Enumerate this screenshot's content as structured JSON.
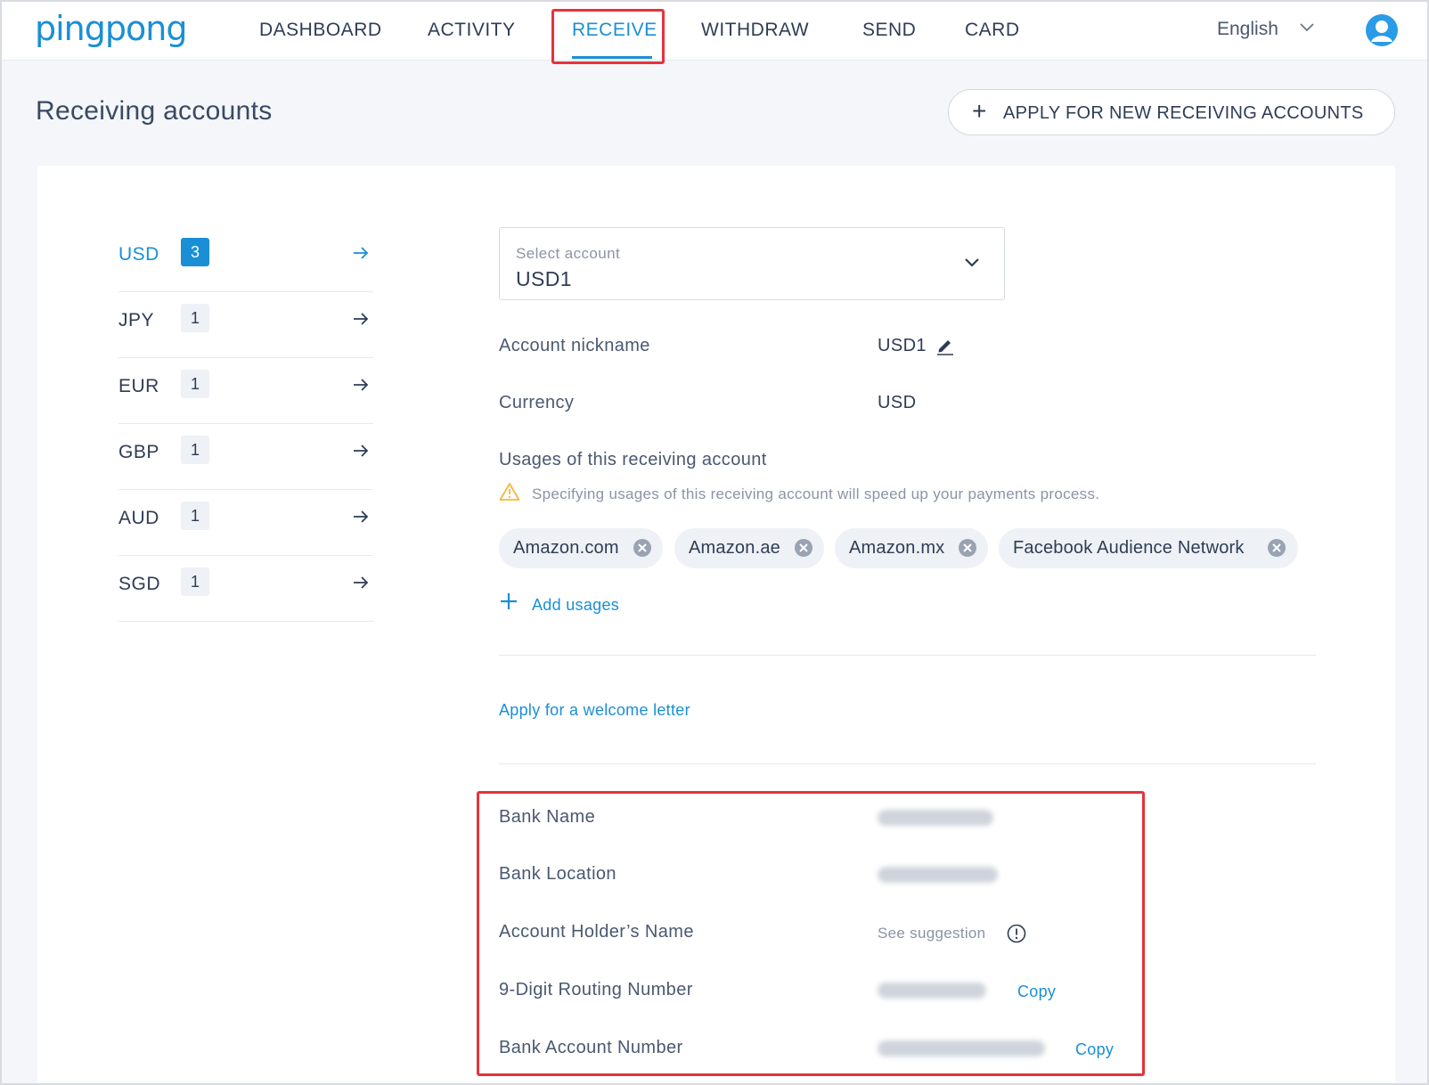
{
  "brand": {
    "logo_text": "pingpong",
    "accent": "#1a8fd6",
    "highlight": "#e7323a"
  },
  "nav": {
    "items": [
      {
        "label": "DASHBOARD"
      },
      {
        "label": "ACTIVITY"
      },
      {
        "label": "RECEIVE",
        "active": true
      },
      {
        "label": "WITHDRAW"
      },
      {
        "label": "SEND"
      },
      {
        "label": "CARD"
      }
    ],
    "language": "English",
    "avatar_icon": "user-avatar-icon"
  },
  "header": {
    "title": "Receiving accounts",
    "apply_button": "APPLY FOR NEW RECEIVING ACCOUNTS"
  },
  "currencies": [
    {
      "code": "USD",
      "count": "3",
      "active": true
    },
    {
      "code": "JPY",
      "count": "1"
    },
    {
      "code": "EUR",
      "count": "1"
    },
    {
      "code": "GBP",
      "count": "1"
    },
    {
      "code": "AUD",
      "count": "1"
    },
    {
      "code": "SGD",
      "count": "1"
    }
  ],
  "account": {
    "select_label": "Select account",
    "select_value": "USD1",
    "nickname_label": "Account nickname",
    "nickname_value": "USD1",
    "currency_label": "Currency",
    "currency_value": "USD",
    "usages_label": "Usages of this receiving account",
    "usages_hint": "Specifying usages of this receiving account will speed up your payments process.",
    "usages": [
      "Amazon.com",
      "Amazon.ae",
      "Amazon.mx",
      "Facebook Audience Network"
    ],
    "add_usages": "Add usages",
    "welcome_letter": "Apply for a welcome letter"
  },
  "bank": {
    "bank_name_label": "Bank Name",
    "bank_location_label": "Bank Location",
    "holder_label": "Account Holder’s Name",
    "holder_value": "See suggestion",
    "routing_label": "9-Digit Routing Number",
    "account_number_label": "Bank Account Number",
    "copy_label": "Copy"
  }
}
